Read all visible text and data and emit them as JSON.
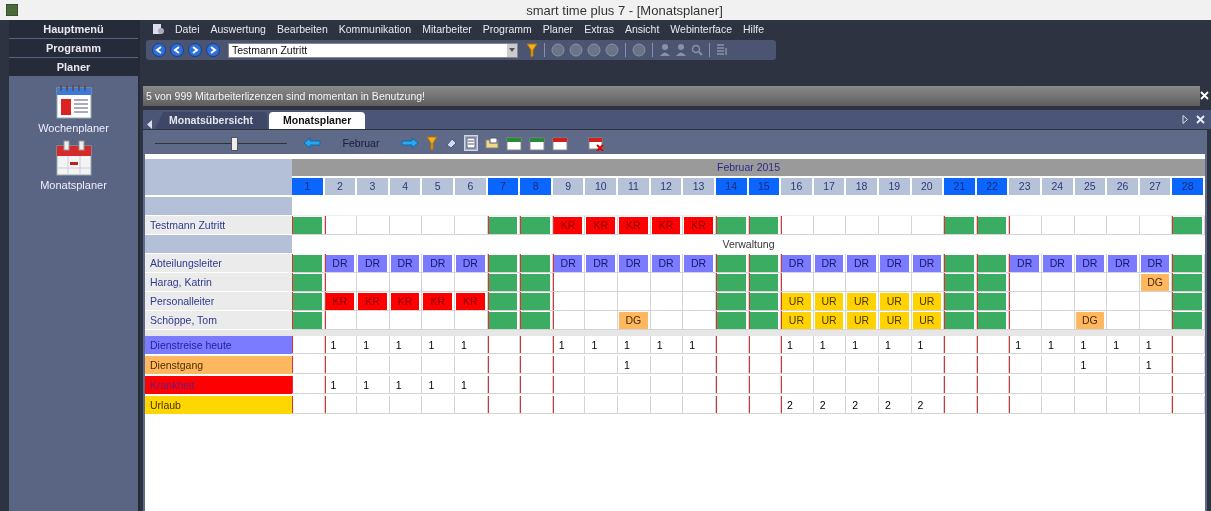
{
  "window": {
    "title": "smart time plus 7 - [Monatsplaner]"
  },
  "sidebar": {
    "sections": [
      {
        "label": "Hauptmenü"
      },
      {
        "label": "Programm"
      },
      {
        "label": "Planer"
      }
    ],
    "items": [
      {
        "label": "Wochenplaner",
        "kind": "week"
      },
      {
        "label": "Monatsplaner",
        "kind": "month"
      }
    ]
  },
  "menu": [
    "Datei",
    "Auswertung",
    "Bearbeiten",
    "Kommunikation",
    "Mitarbeiter",
    "Programm",
    "Planer",
    "Extras",
    "Ansicht",
    "Webinterface",
    "Hilfe"
  ],
  "toolbar": {
    "employee": "Testmann Zutritt"
  },
  "message": "5 von 999 Mitarbeiterlizenzen sind momentan in Benutzung!",
  "tabs": [
    {
      "label": "Monatsübersicht",
      "selected": false
    },
    {
      "label": "Monatsplaner",
      "selected": true
    }
  ],
  "planner_toolbar": {
    "level": 0.6,
    "month": "Februar"
  },
  "planner": {
    "month_title": "Februar 2015",
    "days": [
      {
        "label": "1",
        "weekend": true
      },
      {
        "label": "2",
        "weekend": false
      },
      {
        "label": "3",
        "weekend": false
      },
      {
        "label": "4",
        "weekend": false
      },
      {
        "label": "5",
        "weekend": false
      },
      {
        "label": "6",
        "weekend": false
      },
      {
        "label": "7",
        "weekend": true
      },
      {
        "label": "8",
        "weekend": true
      },
      {
        "label": "9",
        "weekend": false
      },
      {
        "label": "10",
        "weekend": false
      },
      {
        "label": "11",
        "weekend": false
      },
      {
        "label": "12",
        "weekend": false
      },
      {
        "label": "13",
        "weekend": false
      },
      {
        "label": "14",
        "weekend": true
      },
      {
        "label": "15",
        "weekend": true
      },
      {
        "label": "16",
        "weekend": false
      },
      {
        "label": "17",
        "weekend": false
      },
      {
        "label": "18",
        "weekend": false
      },
      {
        "label": "19",
        "weekend": false
      },
      {
        "label": "20",
        "weekend": false
      },
      {
        "label": "21",
        "weekend": true
      },
      {
        "label": "22",
        "weekend": true
      },
      {
        "label": "23",
        "weekend": false
      },
      {
        "label": "24",
        "weekend": false
      },
      {
        "label": "25",
        "weekend": false
      },
      {
        "label": "26",
        "weekend": false
      },
      {
        "label": "27",
        "weekend": false
      },
      {
        "label": "28",
        "weekend": true
      }
    ],
    "rows": [
      {
        "kind": "blank"
      },
      {
        "kind": "employee",
        "name": "Testmann Zutritt",
        "cells": [
          {
            "kind": "empty"
          },
          {
            "kind": "empty"
          },
          {
            "kind": "empty"
          },
          {
            "kind": "empty"
          },
          {
            "kind": "empty"
          },
          {
            "kind": "empty"
          },
          {
            "kind": "empty"
          },
          {
            "kind": "empty"
          },
          {
            "kind": "kr",
            "text": "KR"
          },
          {
            "kind": "kr",
            "text": "KR"
          },
          {
            "kind": "kr",
            "text": "KR"
          },
          {
            "kind": "kr",
            "text": "KR"
          },
          {
            "kind": "kr",
            "text": "KR"
          },
          {
            "kind": "empty"
          },
          {
            "kind": "empty"
          },
          {
            "kind": "empty"
          },
          {
            "kind": "empty"
          },
          {
            "kind": "empty"
          },
          {
            "kind": "empty"
          },
          {
            "kind": "empty"
          },
          {
            "kind": "empty"
          },
          {
            "kind": "empty"
          },
          {
            "kind": "empty"
          },
          {
            "kind": "empty"
          },
          {
            "kind": "empty"
          },
          {
            "kind": "empty"
          },
          {
            "kind": "empty"
          },
          {
            "kind": "empty"
          }
        ]
      },
      {
        "kind": "group",
        "label": "Verwaltung"
      },
      {
        "kind": "employee",
        "name": "Abteilungsleiter",
        "cells": [
          {
            "kind": "empty"
          },
          {
            "kind": "dr",
            "text": "DR"
          },
          {
            "kind": "dr",
            "text": "DR"
          },
          {
            "kind": "dr",
            "text": "DR"
          },
          {
            "kind": "dr",
            "text": "DR"
          },
          {
            "kind": "dr",
            "text": "DR"
          },
          {
            "kind": "empty"
          },
          {
            "kind": "empty"
          },
          {
            "kind": "dr",
            "text": "DR"
          },
          {
            "kind": "dr",
            "text": "DR"
          },
          {
            "kind": "dr",
            "text": "DR"
          },
          {
            "kind": "dr",
            "text": "DR"
          },
          {
            "kind": "dr",
            "text": "DR"
          },
          {
            "kind": "empty"
          },
          {
            "kind": "empty"
          },
          {
            "kind": "dr",
            "text": "DR"
          },
          {
            "kind": "dr",
            "text": "DR"
          },
          {
            "kind": "dr",
            "text": "DR"
          },
          {
            "kind": "dr",
            "text": "DR"
          },
          {
            "kind": "dr",
            "text": "DR"
          },
          {
            "kind": "empty"
          },
          {
            "kind": "empty"
          },
          {
            "kind": "dr",
            "text": "DR"
          },
          {
            "kind": "dr",
            "text": "DR"
          },
          {
            "kind": "dr",
            "text": "DR"
          },
          {
            "kind": "dr",
            "text": "DR"
          },
          {
            "kind": "dr",
            "text": "DR"
          },
          {
            "kind": "empty"
          }
        ]
      },
      {
        "kind": "employee",
        "name": "Harag, Katrin",
        "cells": [
          {
            "kind": "empty"
          },
          {
            "kind": "empty"
          },
          {
            "kind": "empty"
          },
          {
            "kind": "empty"
          },
          {
            "kind": "empty"
          },
          {
            "kind": "empty"
          },
          {
            "kind": "empty"
          },
          {
            "kind": "empty"
          },
          {
            "kind": "empty"
          },
          {
            "kind": "empty"
          },
          {
            "kind": "empty"
          },
          {
            "kind": "empty"
          },
          {
            "kind": "empty"
          },
          {
            "kind": "empty"
          },
          {
            "kind": "empty"
          },
          {
            "kind": "empty"
          },
          {
            "kind": "empty"
          },
          {
            "kind": "empty"
          },
          {
            "kind": "empty"
          },
          {
            "kind": "empty"
          },
          {
            "kind": "empty"
          },
          {
            "kind": "empty"
          },
          {
            "kind": "empty"
          },
          {
            "kind": "empty"
          },
          {
            "kind": "empty"
          },
          {
            "kind": "empty"
          },
          {
            "kind": "dg",
            "text": "DG"
          },
          {
            "kind": "empty"
          }
        ]
      },
      {
        "kind": "employee",
        "name": "Personalleiter",
        "cells": [
          {
            "kind": "empty"
          },
          {
            "kind": "kr",
            "text": "KR"
          },
          {
            "kind": "kr",
            "text": "KR"
          },
          {
            "kind": "kr",
            "text": "KR"
          },
          {
            "kind": "kr",
            "text": "KR"
          },
          {
            "kind": "kr",
            "text": "KR"
          },
          {
            "kind": "empty"
          },
          {
            "kind": "empty"
          },
          {
            "kind": "empty"
          },
          {
            "kind": "empty"
          },
          {
            "kind": "empty"
          },
          {
            "kind": "empty"
          },
          {
            "kind": "empty"
          },
          {
            "kind": "empty"
          },
          {
            "kind": "empty"
          },
          {
            "kind": "ur",
            "text": "UR"
          },
          {
            "kind": "ur",
            "text": "UR"
          },
          {
            "kind": "ur",
            "text": "UR"
          },
          {
            "kind": "ur",
            "text": "UR"
          },
          {
            "kind": "ur",
            "text": "UR"
          },
          {
            "kind": "empty"
          },
          {
            "kind": "empty"
          },
          {
            "kind": "empty"
          },
          {
            "kind": "empty"
          },
          {
            "kind": "empty"
          },
          {
            "kind": "empty"
          },
          {
            "kind": "empty"
          },
          {
            "kind": "empty"
          }
        ]
      },
      {
        "kind": "employee",
        "name": "Schöppe, Tom",
        "cells": [
          {
            "kind": "empty"
          },
          {
            "kind": "empty"
          },
          {
            "kind": "empty"
          },
          {
            "kind": "empty"
          },
          {
            "kind": "empty"
          },
          {
            "kind": "empty"
          },
          {
            "kind": "empty"
          },
          {
            "kind": "empty"
          },
          {
            "kind": "empty"
          },
          {
            "kind": "empty"
          },
          {
            "kind": "dg",
            "text": "DG"
          },
          {
            "kind": "empty"
          },
          {
            "kind": "empty"
          },
          {
            "kind": "empty"
          },
          {
            "kind": "empty"
          },
          {
            "kind": "ur",
            "text": "UR"
          },
          {
            "kind": "ur",
            "text": "UR"
          },
          {
            "kind": "ur",
            "text": "UR"
          },
          {
            "kind": "ur",
            "text": "UR"
          },
          {
            "kind": "ur",
            "text": "UR"
          },
          {
            "kind": "empty"
          },
          {
            "kind": "empty"
          },
          {
            "kind": "empty"
          },
          {
            "kind": "empty"
          },
          {
            "kind": "dg",
            "text": "DG"
          },
          {
            "kind": "empty"
          },
          {
            "kind": "empty"
          },
          {
            "kind": "empty"
          }
        ]
      }
    ],
    "legend": [
      {
        "label": "Dienstreise heute",
        "color": "#7b7bff",
        "counts": [
          {
            "kind": "empty"
          },
          {
            "kind": "count",
            "text": "1"
          },
          {
            "kind": "count",
            "text": "1"
          },
          {
            "kind": "count",
            "text": "1"
          },
          {
            "kind": "count",
            "text": "1"
          },
          {
            "kind": "count",
            "text": "1"
          },
          {
            "kind": "empty"
          },
          {
            "kind": "empty"
          },
          {
            "kind": "count",
            "text": "1"
          },
          {
            "kind": "count",
            "text": "1"
          },
          {
            "kind": "count",
            "text": "1"
          },
          {
            "kind": "count",
            "text": "1"
          },
          {
            "kind": "count",
            "text": "1"
          },
          {
            "kind": "empty"
          },
          {
            "kind": "empty"
          },
          {
            "kind": "count",
            "text": "1"
          },
          {
            "kind": "count",
            "text": "1"
          },
          {
            "kind": "count",
            "text": "1"
          },
          {
            "kind": "count",
            "text": "1"
          },
          {
            "kind": "count",
            "text": "1"
          },
          {
            "kind": "empty"
          },
          {
            "kind": "empty"
          },
          {
            "kind": "count",
            "text": "1"
          },
          {
            "kind": "count",
            "text": "1"
          },
          {
            "kind": "count",
            "text": "1"
          },
          {
            "kind": "count",
            "text": "1"
          },
          {
            "kind": "count",
            "text": "1"
          },
          {
            "kind": "empty"
          }
        ]
      },
      {
        "label": "Dienstgang",
        "color": "#ffb760",
        "counts": [
          {
            "kind": "empty"
          },
          {
            "kind": "empty"
          },
          {
            "kind": "empty"
          },
          {
            "kind": "empty"
          },
          {
            "kind": "empty"
          },
          {
            "kind": "empty"
          },
          {
            "kind": "empty"
          },
          {
            "kind": "empty"
          },
          {
            "kind": "empty"
          },
          {
            "kind": "empty"
          },
          {
            "kind": "count",
            "text": "1"
          },
          {
            "kind": "empty"
          },
          {
            "kind": "empty"
          },
          {
            "kind": "empty"
          },
          {
            "kind": "empty"
          },
          {
            "kind": "empty"
          },
          {
            "kind": "empty"
          },
          {
            "kind": "empty"
          },
          {
            "kind": "empty"
          },
          {
            "kind": "empty"
          },
          {
            "kind": "empty"
          },
          {
            "kind": "empty"
          },
          {
            "kind": "empty"
          },
          {
            "kind": "empty"
          },
          {
            "kind": "count",
            "text": "1"
          },
          {
            "kind": "empty"
          },
          {
            "kind": "count",
            "text": "1"
          },
          {
            "kind": "empty"
          }
        ]
      },
      {
        "label": "Krankheit",
        "color": "#ff0000",
        "counts": [
          {
            "kind": "empty"
          },
          {
            "kind": "count",
            "text": "1"
          },
          {
            "kind": "count",
            "text": "1"
          },
          {
            "kind": "count",
            "text": "1"
          },
          {
            "kind": "count",
            "text": "1"
          },
          {
            "kind": "count",
            "text": "1"
          },
          {
            "kind": "empty"
          },
          {
            "kind": "empty"
          },
          {
            "kind": "empty"
          },
          {
            "kind": "empty"
          },
          {
            "kind": "empty"
          },
          {
            "kind": "empty"
          },
          {
            "kind": "empty"
          },
          {
            "kind": "empty"
          },
          {
            "kind": "empty"
          },
          {
            "kind": "empty"
          },
          {
            "kind": "empty"
          },
          {
            "kind": "empty"
          },
          {
            "kind": "empty"
          },
          {
            "kind": "empty"
          },
          {
            "kind": "empty"
          },
          {
            "kind": "empty"
          },
          {
            "kind": "empty"
          },
          {
            "kind": "empty"
          },
          {
            "kind": "empty"
          },
          {
            "kind": "empty"
          },
          {
            "kind": "empty"
          },
          {
            "kind": "empty"
          }
        ]
      },
      {
        "label": "Urlaub",
        "color": "#ffd700",
        "counts": [
          {
            "kind": "empty"
          },
          {
            "kind": "empty"
          },
          {
            "kind": "empty"
          },
          {
            "kind": "empty"
          },
          {
            "kind": "empty"
          },
          {
            "kind": "empty"
          },
          {
            "kind": "empty"
          },
          {
            "kind": "empty"
          },
          {
            "kind": "empty"
          },
          {
            "kind": "empty"
          },
          {
            "kind": "empty"
          },
          {
            "kind": "empty"
          },
          {
            "kind": "empty"
          },
          {
            "kind": "empty"
          },
          {
            "kind": "empty"
          },
          {
            "kind": "count",
            "text": "2"
          },
          {
            "kind": "count",
            "text": "2"
          },
          {
            "kind": "count",
            "text": "2"
          },
          {
            "kind": "count",
            "text": "2"
          },
          {
            "kind": "count",
            "text": "2"
          },
          {
            "kind": "empty"
          },
          {
            "kind": "empty"
          },
          {
            "kind": "empty"
          },
          {
            "kind": "empty"
          },
          {
            "kind": "empty"
          },
          {
            "kind": "empty"
          },
          {
            "kind": "empty"
          },
          {
            "kind": "empty"
          }
        ]
      }
    ]
  }
}
